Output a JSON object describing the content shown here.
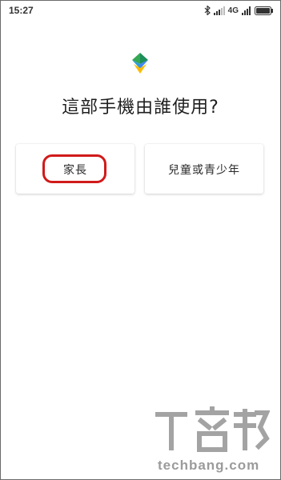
{
  "status_bar": {
    "time": "15:27",
    "network": "4G",
    "icons": [
      "bluetooth-icon",
      "signal-icon",
      "battery-icon"
    ]
  },
  "app": {
    "logo": "family-link-logo",
    "question": "這部手機由誰使用?"
  },
  "choices": [
    {
      "label": "家長"
    },
    {
      "label": "兒童或青少年"
    }
  ],
  "annotation": {
    "highlight_color": "#d11a1a"
  },
  "watermark": {
    "logo_text": "T客邦",
    "url": "techbang.com"
  }
}
